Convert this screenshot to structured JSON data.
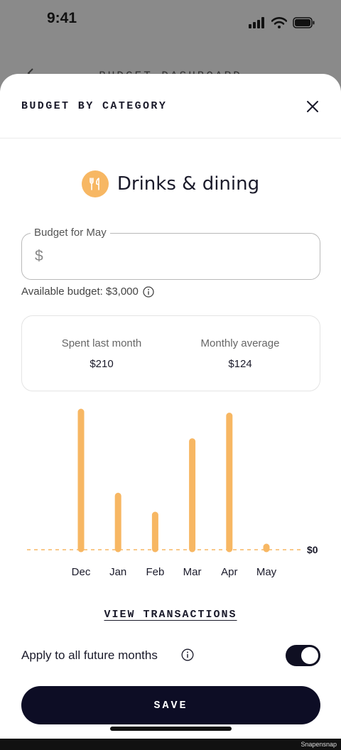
{
  "status_bar": {
    "time": "9:41"
  },
  "background_screen": {
    "title": "BUDGET DASHBOARD"
  },
  "sheet": {
    "title": "BUDGET BY CATEGORY",
    "category": {
      "name": "Drinks & dining",
      "icon": "fork-knife-icon",
      "color": "#f7b763"
    },
    "budget_field": {
      "label": "Budget for May",
      "currency": "$",
      "value": "",
      "placeholder": ""
    },
    "available_budget": "Available budget: $3,000",
    "stats": {
      "spent_label": "Spent last month",
      "spent_value": "$210",
      "average_label": "Monthly average",
      "average_value": "$124"
    },
    "view_transactions": "VIEW TRANSACTIONS",
    "apply_future": {
      "label": "Apply to all future months",
      "enabled": true
    },
    "save_label": "SAVE"
  },
  "chart_data": {
    "type": "bar",
    "categories": [
      "Dec",
      "Jan",
      "Feb",
      "Mar",
      "Apr",
      "May"
    ],
    "values": [
      210,
      82,
      53,
      165,
      204,
      4
    ],
    "baseline_label": "$0",
    "bar_color": "#f7b763"
  },
  "watermark": "Snapensnap"
}
